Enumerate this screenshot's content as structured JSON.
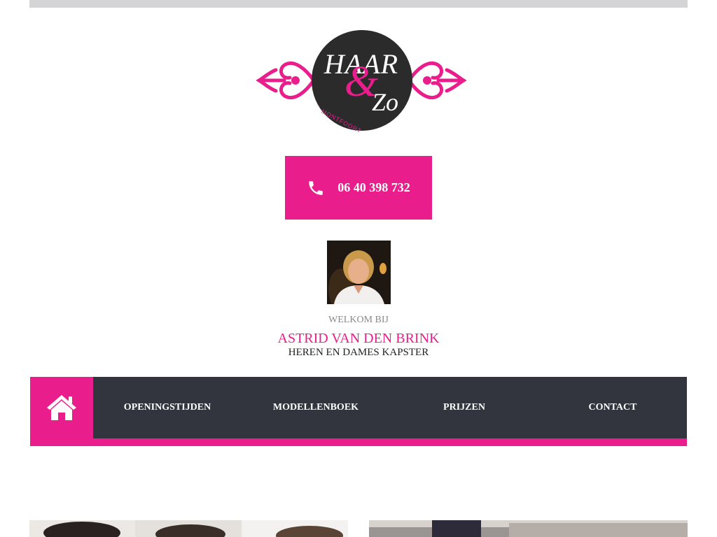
{
  "brand": {
    "logo_line1": "HAAR",
    "logo_amp": "&",
    "logo_line2": "Zo",
    "logo_sub": "MONTFOORT",
    "accent": "#e91e8c",
    "dark": "#32353d"
  },
  "phone": {
    "icon": "phone-icon",
    "number": "06 40 398 732"
  },
  "intro": {
    "welcome": "WELKOM BIJ",
    "name": "ASTRID VAN DEN BRINK",
    "subtitle": "HEREN EN DAMES KAPSTER"
  },
  "nav": {
    "home_icon": "home-icon",
    "items": [
      "OPENINGSTIJDEN",
      "MODELLENBOEK",
      "PRIJZEN",
      "CONTACT"
    ]
  }
}
